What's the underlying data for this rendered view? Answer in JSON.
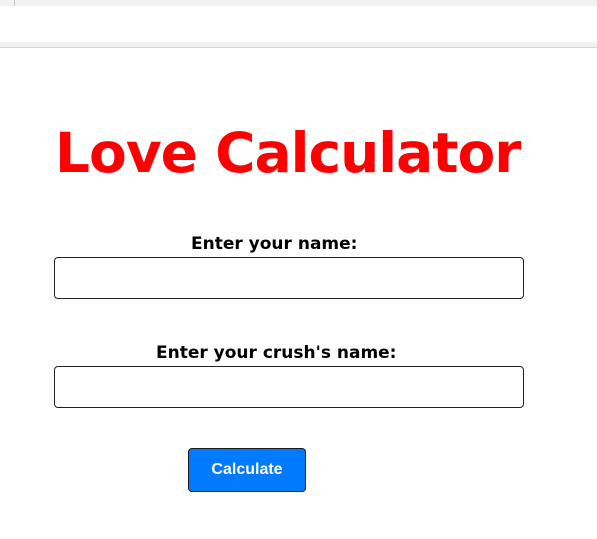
{
  "app": {
    "title": "Love Calculator"
  },
  "form": {
    "name_label": "Enter your name:",
    "name_value": "",
    "crush_label": "Enter your crush's name:",
    "crush_value": "",
    "submit_label": "Calculate"
  },
  "colors": {
    "title": "#ff0000",
    "button": "#007bff",
    "button_text": "#ffffff"
  }
}
